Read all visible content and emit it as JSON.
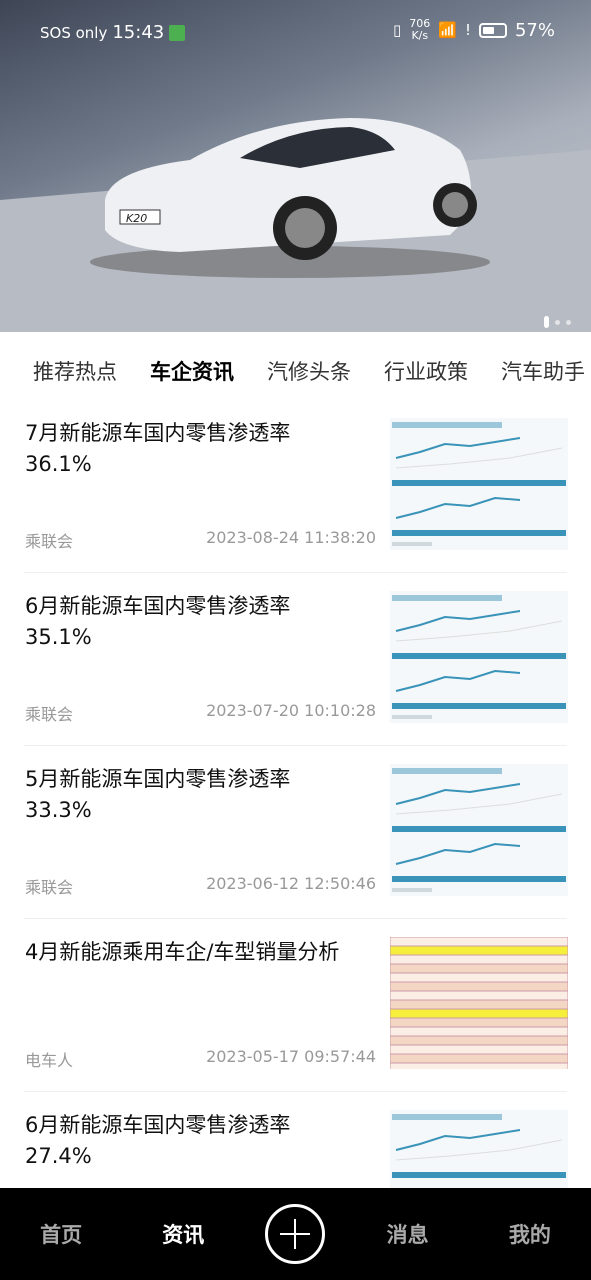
{
  "status": {
    "carrier": "SOS only",
    "time": "15:43",
    "speed_value": "706",
    "speed_unit": "K/s",
    "battery": "57%",
    "battery_level": 57
  },
  "hero": {
    "plate": "K20",
    "slides": 3,
    "active_slide": 0
  },
  "tabs": [
    {
      "label": "推荐热点"
    },
    {
      "label": "车企资讯",
      "active": true
    },
    {
      "label": "汽修头条"
    },
    {
      "label": "行业政策"
    },
    {
      "label": "汽车助手"
    }
  ],
  "articles": [
    {
      "title": "7月新能源车国内零售渗透率36.1%",
      "source": "乘联会",
      "time": "2023-08-24 11:38:20",
      "thumb": "chart"
    },
    {
      "title": "6月新能源车国内零售渗透率35.1%",
      "source": "乘联会",
      "time": "2023-07-20 10:10:28",
      "thumb": "chart"
    },
    {
      "title": "5月新能源车国内零售渗透率33.3%",
      "source": "乘联会",
      "time": "2023-06-12 12:50:46",
      "thumb": "chart"
    },
    {
      "title": "4月新能源乘用车企/车型销量分析",
      "source": "电车人",
      "time": "2023-05-17 09:57:44",
      "thumb": "table"
    },
    {
      "title": "6月新能源车国内零售渗透率27.4%",
      "source": "",
      "time": "",
      "thumb": "chart"
    }
  ],
  "nav": [
    {
      "label": "首页"
    },
    {
      "label": "资讯",
      "active": true
    },
    {
      "label": "",
      "icon": "plus-circle-icon"
    },
    {
      "label": "消息"
    },
    {
      "label": "我的"
    }
  ],
  "colors": {
    "accent": "#000000",
    "chart_blue": "#3a93b8"
  }
}
